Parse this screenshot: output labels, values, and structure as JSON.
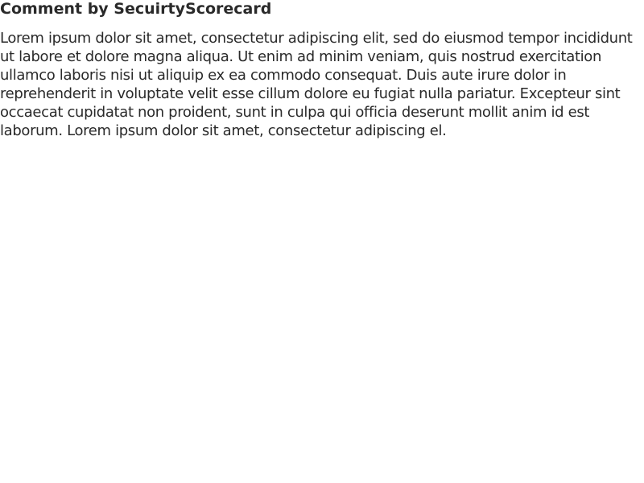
{
  "comment": {
    "title": "Comment by SecuirtyScorecard",
    "body": "Lorem ipsum dolor sit amet, consectetur adipiscing elit, sed do eiusmod tempor incididunt ut labore et dolore magna aliqua. Ut enim ad minim veniam, quis nostrud exercitation ullamco laboris nisi ut aliquip ex ea commodo consequat. Duis aute irure dolor in reprehenderit in voluptate velit esse cillum dolore eu fugiat nulla pariatur. Excepteur sint occaecat cupidatat non proident, sunt in culpa qui officia deserunt mollit anim id est laborum. Lorem ipsum dolor sit amet, consectetur adipiscing el."
  }
}
